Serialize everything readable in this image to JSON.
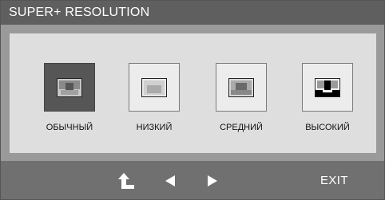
{
  "title": "SUPER+ RESOLUTION",
  "options": [
    {
      "label": "ОБЫЧНЫЙ",
      "selected": true,
      "icon": "resolution-normal-icon"
    },
    {
      "label": "НИЗКИЙ",
      "selected": false,
      "icon": "resolution-low-icon"
    },
    {
      "label": "СРЕДНИЙ",
      "selected": false,
      "icon": "resolution-medium-icon"
    },
    {
      "label": "ВЫСОКИЙ",
      "selected": false,
      "icon": "resolution-high-icon"
    }
  ],
  "footer": {
    "back_icon": "return-arrow-icon",
    "left_icon": "left-arrow-icon",
    "right_icon": "right-arrow-icon",
    "exit_label": "EXIT"
  },
  "colors": {
    "title_bar": "#5f5f5f",
    "panel": "#dedede",
    "selected": "#565656",
    "footer": "#707070"
  }
}
